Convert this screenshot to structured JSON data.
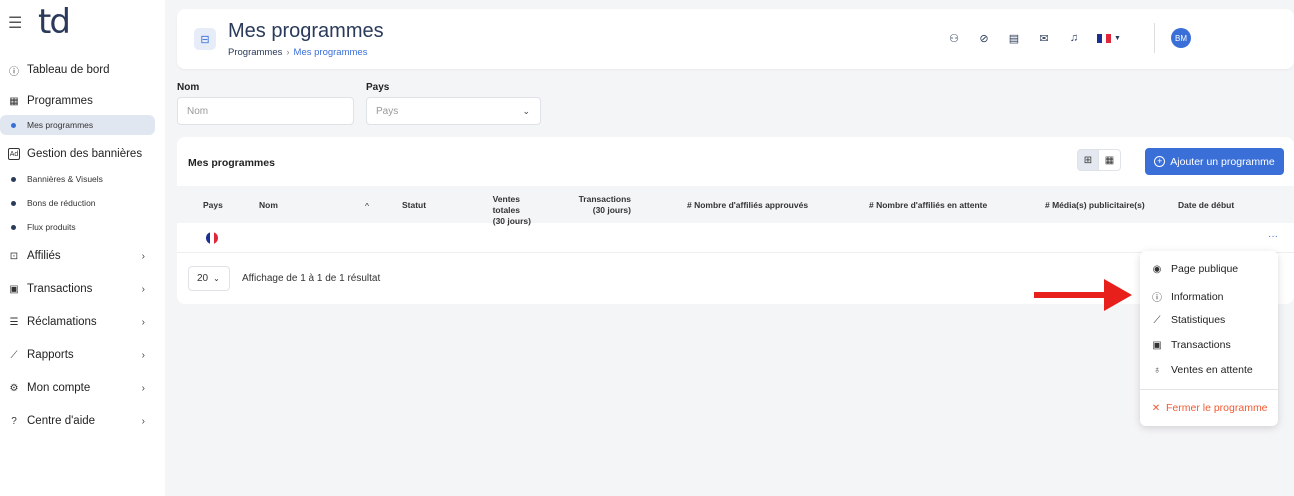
{
  "sidebar": {
    "logo": "td",
    "items": {
      "dashboard": "Tableau de bord",
      "programs": "Programmes",
      "my_programs": "Mes programmes",
      "banners": "Gestion des bannières",
      "banners_visuals": "Bannières & Visuels",
      "coupons": "Bons de réduction",
      "feeds": "Flux produits",
      "affiliates": "Affiliés",
      "transactions": "Transactions",
      "claims": "Réclamations",
      "reports": "Rapports",
      "account": "Mon compte",
      "help": "Centre d'aide"
    }
  },
  "header": {
    "title": "Mes programmes",
    "breadcrumb_root": "Programmes",
    "breadcrumb_sep": "›",
    "breadcrumb_current": "Mes programmes",
    "avatar": "BM"
  },
  "filters": {
    "name_label": "Nom",
    "name_placeholder": "Nom",
    "country_label": "Pays",
    "country_placeholder": "Pays"
  },
  "table": {
    "title": "Mes programmes",
    "add_button": "Ajouter un programme",
    "columns": {
      "country": "Pays",
      "name": "Nom",
      "sort": "^",
      "status": "Statut",
      "sales_1": "Ventes totales",
      "sales_2": "(30 jours)",
      "tx_1": "Transactions",
      "tx_2": "(30 jours)",
      "approved": "# Nombre d'affiliés approuvés",
      "pending": "# Nombre d'affiliés en attente",
      "media": "# Média(s) publicitaire(s)",
      "start": "Date de début"
    },
    "row_more": "···",
    "page_size": "20",
    "page_info": "Affichage de 1 à 1 de 1 résultat"
  },
  "menu": {
    "public_page": "Page publique",
    "information": "Information",
    "statistics": "Statistiques",
    "transactions": "Transactions",
    "pending_sales": "Ventes en attente",
    "close_program": "Fermer le programme"
  },
  "colors": {
    "accent": "#3a6fd8",
    "danger": "#f05a33",
    "arrow": "#e8201c",
    "flag_blue": "#1a2f8f",
    "flag_red": "#e0263b"
  }
}
